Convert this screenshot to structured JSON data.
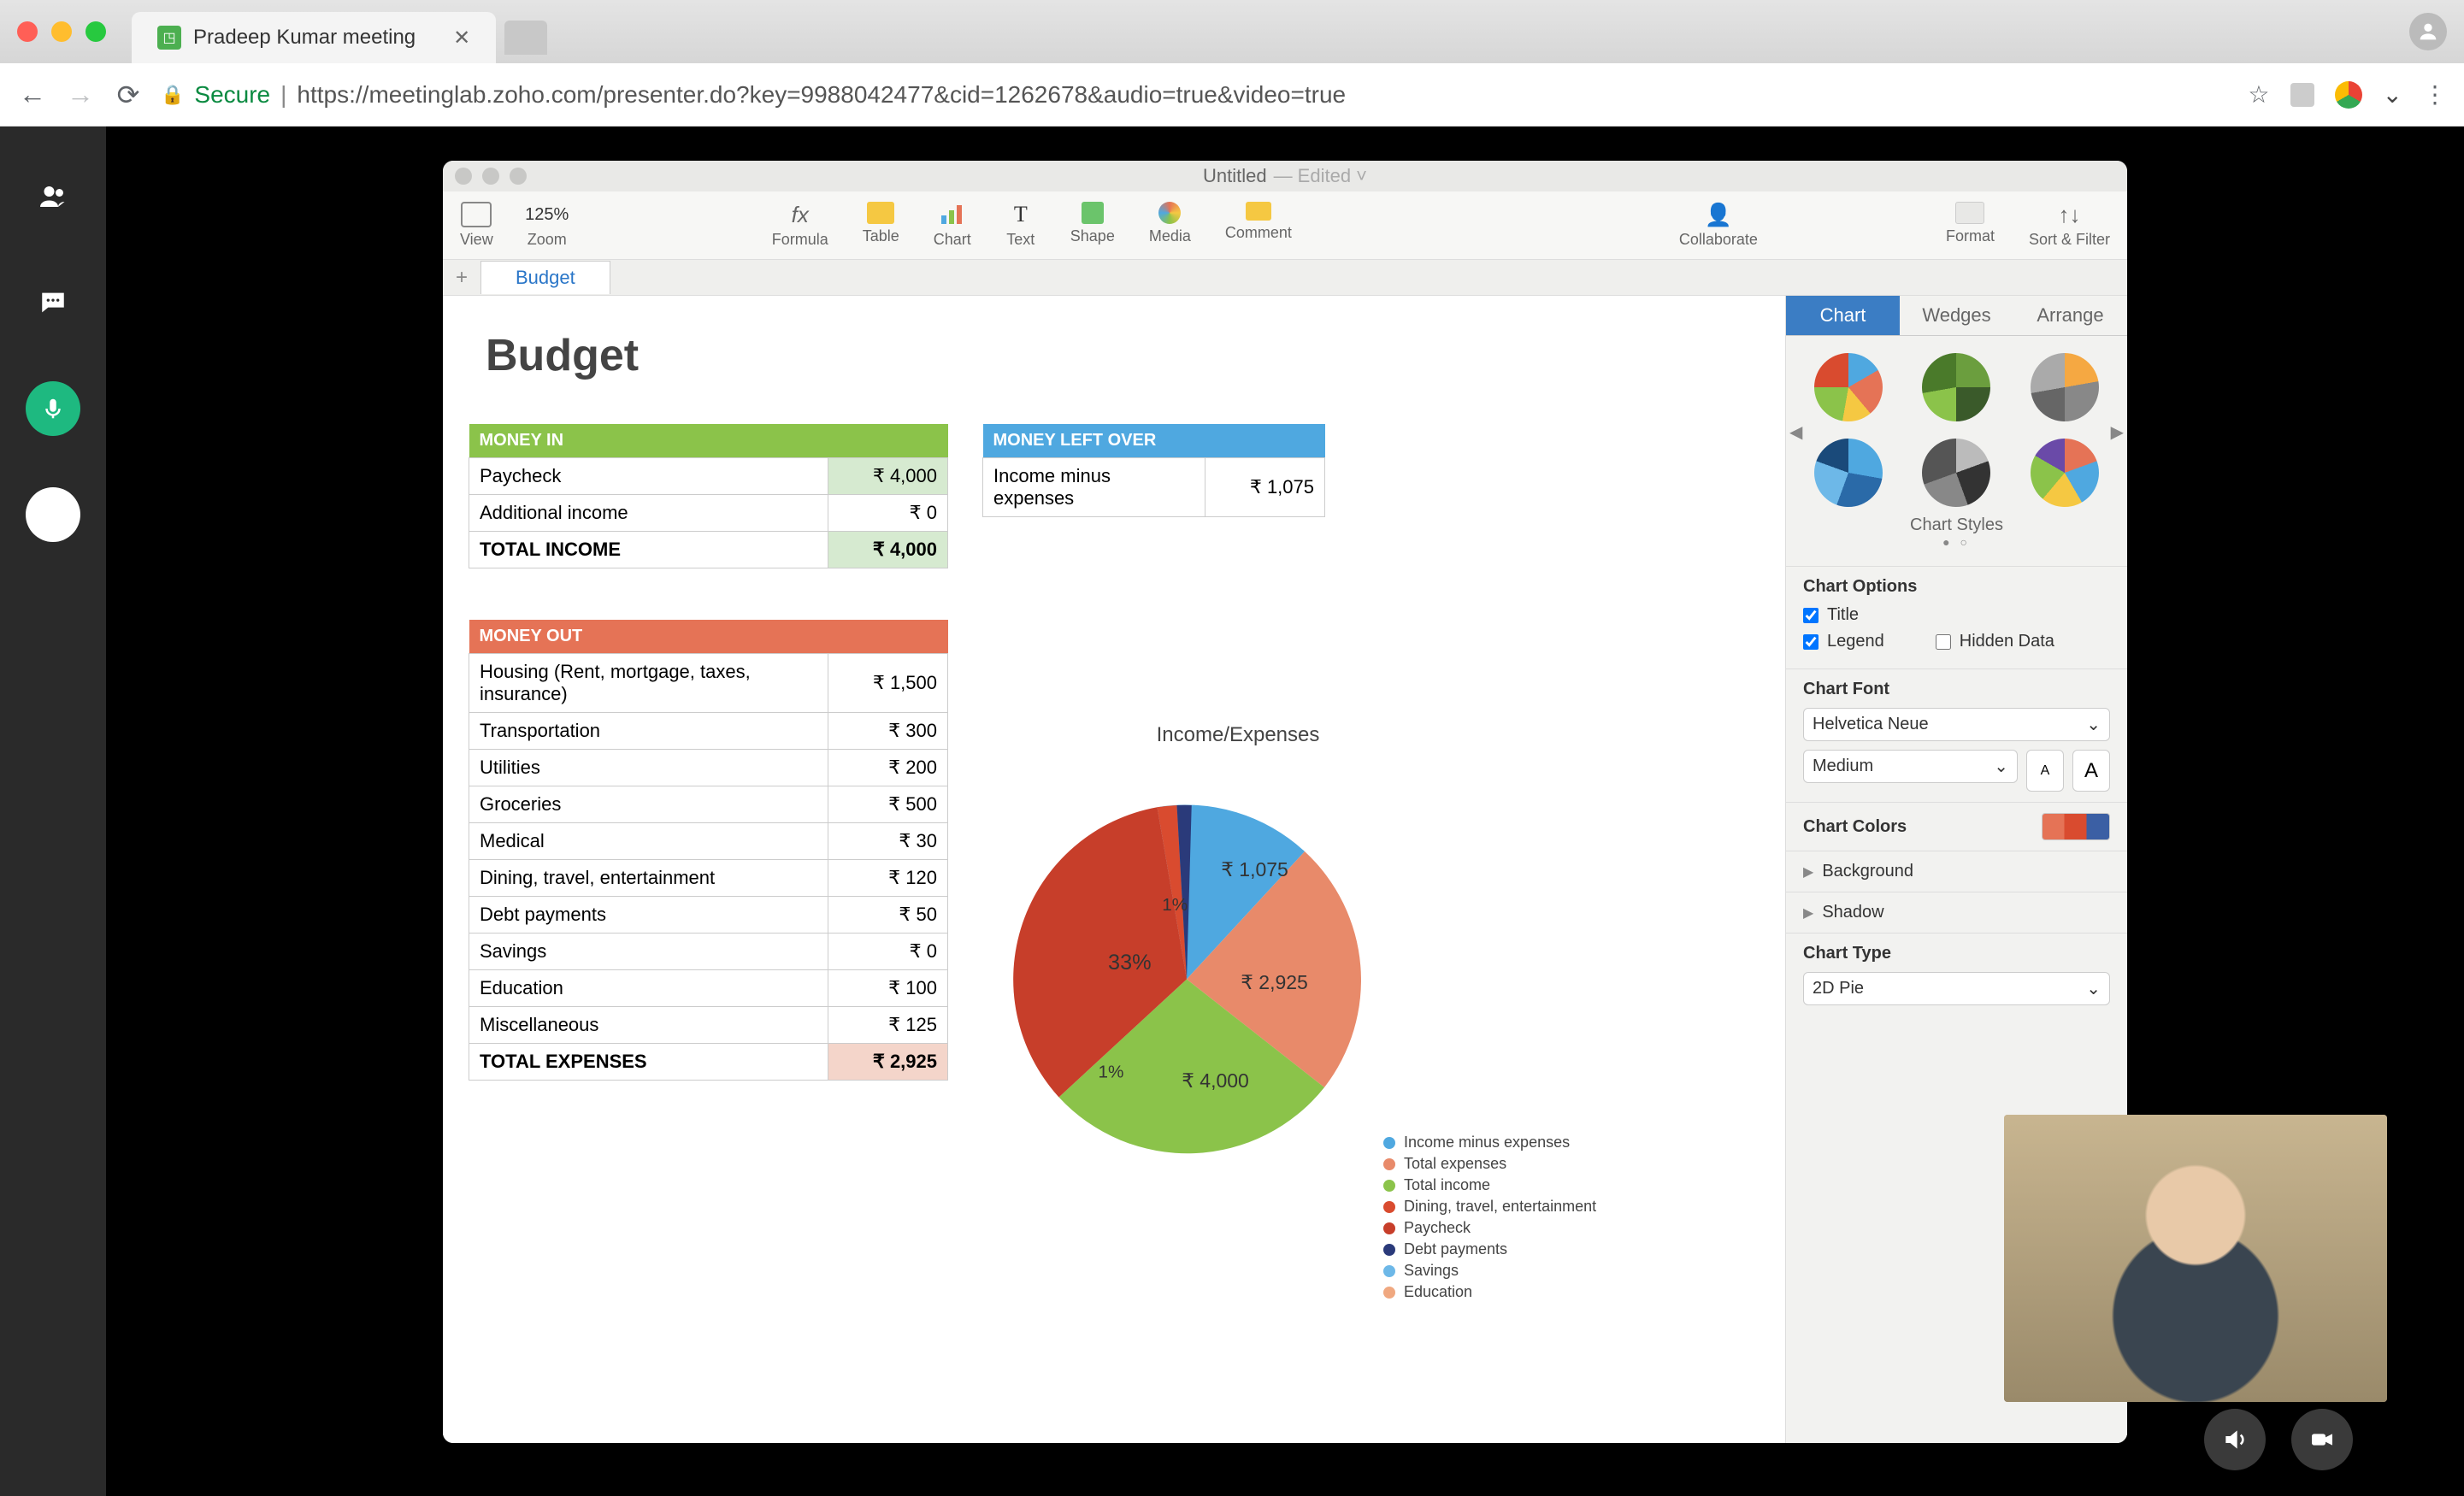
{
  "browser": {
    "tab_title": "Pradeep Kumar meeting",
    "secure_label": "Secure",
    "url": "https://meetinglab.zoho.com/presenter.do?key=9988042477&cid=1262678&audio=true&video=true"
  },
  "app": {
    "title": "Untitled",
    "title_status": "— Edited ˅",
    "toolbar": {
      "zoom_value": "125%",
      "items": [
        "View",
        "Zoom",
        "Formula",
        "Table",
        "Chart",
        "Text",
        "Shape",
        "Media",
        "Comment",
        "Collaborate",
        "Format",
        "Sort & Filter"
      ]
    },
    "sheet_tab": "Budget"
  },
  "doc": {
    "heading": "Budget",
    "money_in": {
      "header": "MONEY IN",
      "rows": [
        {
          "label": "Paycheck",
          "value": "₹ 4,000"
        },
        {
          "label": "Additional income",
          "value": "₹ 0"
        }
      ],
      "total_label": "TOTAL INCOME",
      "total_value": "₹ 4,000"
    },
    "money_left": {
      "header": "MONEY LEFT OVER",
      "row_label": "Income minus expenses",
      "row_value": "₹ 1,075"
    },
    "money_out": {
      "header": "MONEY OUT",
      "rows": [
        {
          "label": "Housing (Rent, mortgage, taxes, insurance)",
          "value": "₹ 1,500"
        },
        {
          "label": "Transportation",
          "value": "₹ 300"
        },
        {
          "label": "Utilities",
          "value": "₹ 200"
        },
        {
          "label": "Groceries",
          "value": "₹ 500"
        },
        {
          "label": "Medical",
          "value": "₹ 30"
        },
        {
          "label": "Dining, travel, entertainment",
          "value": "₹ 120",
          "soft": true
        },
        {
          "label": "Debt payments",
          "value": "₹ 50"
        },
        {
          "label": "Savings",
          "value": "₹ 0",
          "soft": true
        },
        {
          "label": "Education",
          "value": "₹ 100",
          "soft": true
        },
        {
          "label": "Miscellaneous",
          "value": "₹ 125"
        }
      ],
      "total_label": "TOTAL EXPENSES",
      "total_value": "₹ 2,925"
    }
  },
  "chart": {
    "title": "Income/Expenses",
    "labels": {
      "slice1": "₹ 1,075",
      "slice1_pct": "1%",
      "slice2": "₹ 2,925",
      "slice3": "₹ 4,000",
      "slice3_pct": "1%",
      "slice_big_pct": "33%"
    },
    "legend": [
      {
        "label": "Income minus expenses",
        "color": "#4fa8e0"
      },
      {
        "label": "Total expenses",
        "color": "#e88a6a"
      },
      {
        "label": "Total income",
        "color": "#8bc34a"
      },
      {
        "label": "Dining, travel, entertainment",
        "color": "#d94b2f"
      },
      {
        "label": "Paycheck",
        "color": "#c73e2a"
      },
      {
        "label": "Debt payments",
        "color": "#2a3a7a"
      },
      {
        "label": "Savings",
        "color": "#6db8e8"
      },
      {
        "label": "Education",
        "color": "#f0a880"
      }
    ]
  },
  "chart_data": {
    "type": "pie",
    "title": "Income/Expenses",
    "series": [
      {
        "name": "Income minus expenses",
        "value": 1075
      },
      {
        "name": "Total expenses",
        "value": 2925
      },
      {
        "name": "Total income",
        "value": 4000
      },
      {
        "name": "Dining, travel, entertainment",
        "value": 120
      },
      {
        "name": "Paycheck",
        "value": 4000
      },
      {
        "name": "Debt payments",
        "value": 50
      },
      {
        "name": "Savings",
        "value": 0
      },
      {
        "name": "Education",
        "value": 100
      }
    ]
  },
  "inspector": {
    "tabs": [
      "Chart",
      "Wedges",
      "Arrange"
    ],
    "styles_label": "Chart Styles",
    "options_heading": "Chart Options",
    "opt_title": "Title",
    "opt_legend": "Legend",
    "opt_hidden": "Hidden Data",
    "font_heading": "Chart Font",
    "font_family": "Helvetica Neue",
    "font_weight": "Medium",
    "colors_heading": "Chart Colors",
    "background": "Background",
    "shadow": "Shadow",
    "type_heading": "Chart Type",
    "type_value": "2D Pie"
  }
}
